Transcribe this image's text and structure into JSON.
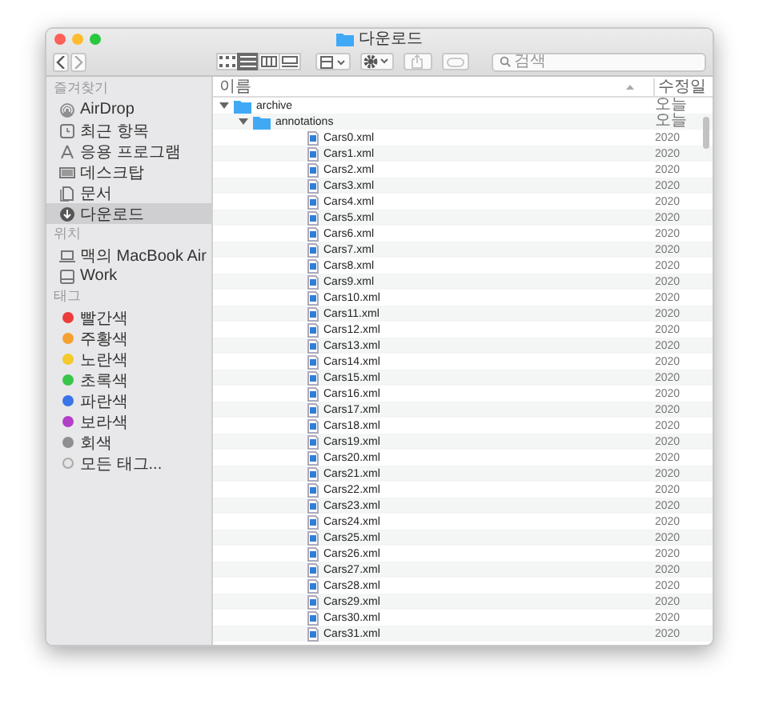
{
  "window": {
    "title": "다운로드"
  },
  "toolbar": {
    "view_modes": [
      {
        "selected": false
      },
      {
        "selected": true
      },
      {
        "selected": false
      },
      {
        "selected": false
      }
    ],
    "search": {
      "placeholder": "검색"
    }
  },
  "sidebar": {
    "sections": [
      {
        "title": "즐겨찾기",
        "items": [
          {
            "label": "AirDrop",
            "selected": false
          },
          {
            "label": "최근 항목",
            "selected": false
          },
          {
            "label": "응용 프로그램",
            "selected": false
          },
          {
            "label": "데스크탑",
            "selected": false
          },
          {
            "label": "문서",
            "selected": false
          },
          {
            "label": "다운로드",
            "selected": true
          }
        ]
      },
      {
        "title": "위치",
        "items": [
          {
            "label": "맥의 MacBook Air",
            "selected": false
          },
          {
            "label": "Work",
            "selected": false
          }
        ]
      }
    ],
    "tags": {
      "title": "태그",
      "items": [
        {
          "label": "빨간색",
          "color": "#ee3b3b"
        },
        {
          "label": "주황색",
          "color": "#f5a030"
        },
        {
          "label": "노란색",
          "color": "#f4c92c"
        },
        {
          "label": "초록색",
          "color": "#3ac54a"
        },
        {
          "label": "파란색",
          "color": "#3a74e8"
        },
        {
          "label": "보라색",
          "color": "#b23fc8"
        },
        {
          "label": "회색",
          "color": "#8e8e93"
        }
      ],
      "all_tags": "모든 태그..."
    }
  },
  "table": {
    "columns": [
      "이름",
      "수정일"
    ],
    "rows": [
      {
        "name": "archive",
        "date": "오늘",
        "kind": "folder",
        "expanded": true,
        "children": [
          {
            "name": "annotations",
            "date": "오늘",
            "kind": "folder",
            "expanded": true,
            "children": [
              {
                "name": "Cars0.xml",
                "date": "2020",
                "kind": "file"
              },
              {
                "name": "Cars1.xml",
                "date": "2020",
                "kind": "file"
              },
              {
                "name": "Cars2.xml",
                "date": "2020",
                "kind": "file"
              },
              {
                "name": "Cars3.xml",
                "date": "2020",
                "kind": "file"
              },
              {
                "name": "Cars4.xml",
                "date": "2020",
                "kind": "file"
              },
              {
                "name": "Cars5.xml",
                "date": "2020",
                "kind": "file"
              },
              {
                "name": "Cars6.xml",
                "date": "2020",
                "kind": "file"
              },
              {
                "name": "Cars7.xml",
                "date": "2020",
                "kind": "file"
              },
              {
                "name": "Cars8.xml",
                "date": "2020",
                "kind": "file"
              },
              {
                "name": "Cars9.xml",
                "date": "2020",
                "kind": "file"
              },
              {
                "name": "Cars10.xml",
                "date": "2020",
                "kind": "file"
              },
              {
                "name": "Cars11.xml",
                "date": "2020",
                "kind": "file"
              },
              {
                "name": "Cars12.xml",
                "date": "2020",
                "kind": "file"
              },
              {
                "name": "Cars13.xml",
                "date": "2020",
                "kind": "file"
              },
              {
                "name": "Cars14.xml",
                "date": "2020",
                "kind": "file"
              },
              {
                "name": "Cars15.xml",
                "date": "2020",
                "kind": "file"
              },
              {
                "name": "Cars16.xml",
                "date": "2020",
                "kind": "file"
              },
              {
                "name": "Cars17.xml",
                "date": "2020",
                "kind": "file"
              },
              {
                "name": "Cars18.xml",
                "date": "2020",
                "kind": "file"
              },
              {
                "name": "Cars19.xml",
                "date": "2020",
                "kind": "file"
              },
              {
                "name": "Cars20.xml",
                "date": "2020",
                "kind": "file"
              },
              {
                "name": "Cars21.xml",
                "date": "2020",
                "kind": "file"
              },
              {
                "name": "Cars22.xml",
                "date": "2020",
                "kind": "file"
              },
              {
                "name": "Cars23.xml",
                "date": "2020",
                "kind": "file"
              },
              {
                "name": "Cars24.xml",
                "date": "2020",
                "kind": "file"
              },
              {
                "name": "Cars25.xml",
                "date": "2020",
                "kind": "file"
              },
              {
                "name": "Cars26.xml",
                "date": "2020",
                "kind": "file"
              },
              {
                "name": "Cars27.xml",
                "date": "2020",
                "kind": "file"
              },
              {
                "name": "Cars28.xml",
                "date": "2020",
                "kind": "file"
              },
              {
                "name": "Cars29.xml",
                "date": "2020",
                "kind": "file"
              },
              {
                "name": "Cars30.xml",
                "date": "2020",
                "kind": "file"
              },
              {
                "name": "Cars31.xml",
                "date": "2020",
                "kind": "file"
              }
            ]
          }
        ]
      }
    ]
  }
}
